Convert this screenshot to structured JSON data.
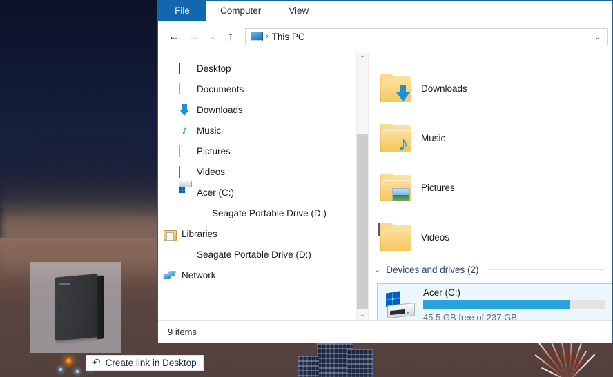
{
  "desktop": {
    "drag_ghost": {
      "name": "Seagate Portable Drive (D:)"
    },
    "drag_tooltip": {
      "glyph": "↷",
      "label": "Create link in Desktop"
    }
  },
  "explorer": {
    "ribbon": {
      "tabs": [
        {
          "label": "File",
          "active": true
        },
        {
          "label": "Computer",
          "active": false
        },
        {
          "label": "View",
          "active": false
        }
      ]
    },
    "navbar": {
      "back": "←",
      "forward": "→",
      "recent": "⌄",
      "up": "↑",
      "address": {
        "icon": "this-pc-icon",
        "separator": "›",
        "crumb": "This PC",
        "chevron": "⌄"
      }
    },
    "navpane": {
      "items": [
        {
          "label": "Desktop",
          "icon": "desktop-icon",
          "indent": 1
        },
        {
          "label": "Documents",
          "icon": "documents-icon",
          "indent": 1
        },
        {
          "label": "Downloads",
          "icon": "downloads-icon",
          "indent": 1
        },
        {
          "label": "Music",
          "icon": "music-icon",
          "indent": 1
        },
        {
          "label": "Pictures",
          "icon": "pictures-icon",
          "indent": 1
        },
        {
          "label": "Videos",
          "icon": "videos-icon",
          "indent": 1
        },
        {
          "label": "Acer (C:)",
          "icon": "hard-drive-icon",
          "indent": 1
        },
        {
          "label": "Seagate Portable Drive (D:)",
          "icon": "external-drive-icon",
          "indent": 2
        },
        {
          "label": "Libraries",
          "icon": "libraries-icon",
          "indent": 0
        },
        {
          "label": "Seagate Portable Drive (D:)",
          "icon": "external-drive-icon",
          "indent": 1
        },
        {
          "label": "Network",
          "icon": "network-icon",
          "indent": 0
        }
      ],
      "scrollbar": {
        "up": "⌃",
        "down": "⌄"
      }
    },
    "content": {
      "folders": [
        {
          "label": "Downloads",
          "icon": "folder-downloads-icon"
        },
        {
          "label": "Music",
          "icon": "folder-music-icon"
        },
        {
          "label": "Pictures",
          "icon": "folder-pictures-icon"
        },
        {
          "label": "Videos",
          "icon": "folder-videos-icon"
        }
      ],
      "group": {
        "chevron": "⌄",
        "title": "Devices and drives (2)"
      },
      "drives": [
        {
          "name": "Acer (C:)",
          "capacity_text": "45.5 GB free of 237 GB",
          "used_percent": 81,
          "bar_color": "#27a3dd",
          "selected": true
        }
      ]
    },
    "statusbar": {
      "items_text": "9 items"
    }
  },
  "colors": {
    "file_tab_blue": "#1268ae",
    "window_border": "#2b5b8a",
    "selection_fill": "#ecf7fd",
    "selection_border": "#9fd4ef",
    "progress_blue": "#27a3dd"
  }
}
